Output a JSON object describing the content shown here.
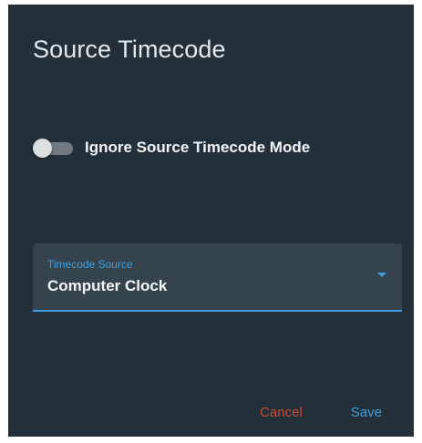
{
  "dialog": {
    "title": "Source Timecode",
    "toggle": {
      "label": "Ignore Source Timecode Mode",
      "checked": false
    },
    "select": {
      "label": "Timecode Source",
      "value": "Computer Clock"
    },
    "buttons": {
      "cancel": "Cancel",
      "save": "Save"
    },
    "colors": {
      "background": "#233039",
      "field_background": "#35434c",
      "accent": "#3f9fe0",
      "cancel": "#c94a3b"
    }
  }
}
